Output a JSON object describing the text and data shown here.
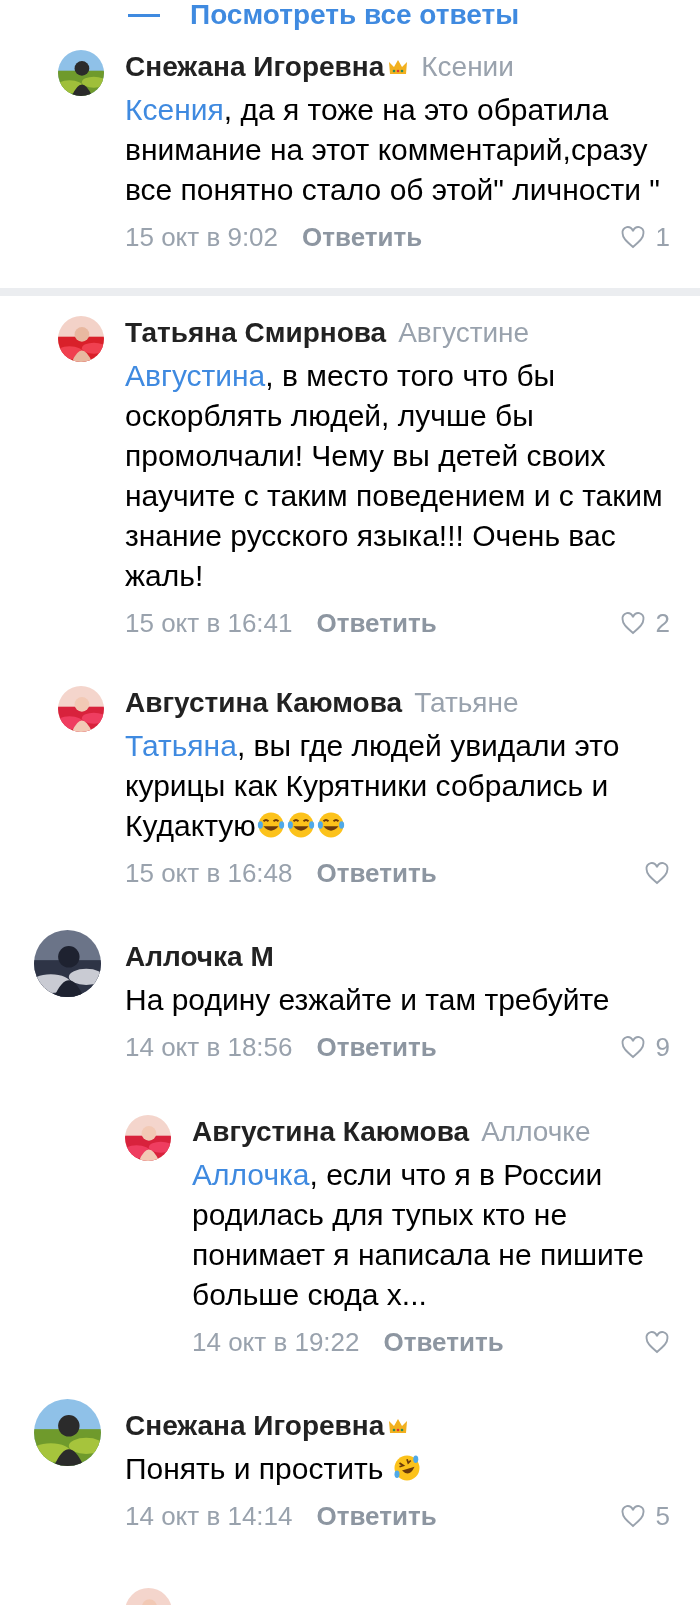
{
  "show_all_replies": {
    "label": "Посмотреть все ответы"
  },
  "comments": [
    {
      "kind": "reply",
      "author": "Снежана Игоревна",
      "crown": true,
      "reply_to": "Ксении",
      "mention": "Ксения",
      "text": ", да я тоже на это обратила внимание на этот комментарий,сразу все понятно стало об этой\" личности \"",
      "date": "15 окт в 9:02",
      "reply_label": "Ответить",
      "likes": "1",
      "divider_after": true
    },
    {
      "kind": "reply",
      "author": "Татьяна Смирнова",
      "crown": false,
      "reply_to": "Августине",
      "mention": "Августина",
      "text": ", в место того что бы оскорблять людей, лучше бы промолчали! Чему вы детей своих научите с таким поведением и с таким знание русского языка!!! Очень вас жаль!",
      "date": "15 окт в 16:41",
      "reply_label": "Ответить",
      "likes": "2",
      "divider_after": false
    },
    {
      "kind": "reply",
      "author": "Августина Каюмова",
      "crown": false,
      "reply_to": "Татьяне",
      "mention": "Татьяна",
      "text": ", вы где людей увидали это курицы как Курятники собрались и Кудактую",
      "emojis": [
        {
          "kind": "tears-of-joy"
        },
        {
          "kind": "tears-of-joy"
        },
        {
          "kind": "tears-of-joy"
        }
      ],
      "date": "15 окт в 16:48",
      "reply_label": "Ответить",
      "divider_after": false
    },
    {
      "kind": "comment",
      "author": "Аллочка М",
      "crown": false,
      "text": "На родину езжайте и там требуйте",
      "date": "14 окт в 18:56",
      "reply_label": "Ответить",
      "likes": "9",
      "divider_after": false,
      "children": [
        {
          "kind": "reply",
          "author": "Августина Каюмова",
          "crown": false,
          "reply_to": "Аллочке",
          "mention": "Аллочка",
          "text": ", если что я в России родилась для тупых кто не понимает я написала не пишите больше сюда х...",
          "date": "14 окт в 19:22",
          "reply_label": "Ответить",
          "divider_after": false
        }
      ]
    },
    {
      "kind": "comment",
      "author": "Снежана Игоревна",
      "crown": true,
      "text": "Понять и простить ",
      "emojis": [
        {
          "kind": "rolling-laughing"
        }
      ],
      "date": "14 окт в 14:14",
      "reply_label": "Ответить",
      "likes": "5",
      "divider_after": false
    }
  ]
}
